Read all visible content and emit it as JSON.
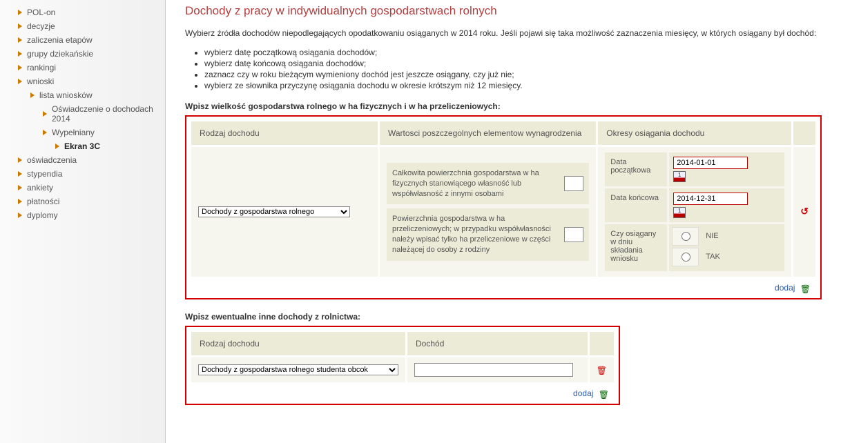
{
  "sidebar": {
    "items": [
      {
        "label": "POL-on",
        "indent": 1
      },
      {
        "label": "decyzje",
        "indent": 1
      },
      {
        "label": "zaliczenia etapów",
        "indent": 1
      },
      {
        "label": "grupy dziekańskie",
        "indent": 1
      },
      {
        "label": "rankingi",
        "indent": 1
      },
      {
        "label": "wnioski",
        "indent": 1
      },
      {
        "label": "lista wniosków",
        "indent": 2
      },
      {
        "label": "Oświadczenie o dochodach 2014",
        "indent": 3
      },
      {
        "label": "Wypełniany",
        "indent": 3
      },
      {
        "label": "Ekran 3C",
        "indent": 4,
        "current": true
      },
      {
        "label": "oświadczenia",
        "indent": 1
      },
      {
        "label": "stypendia",
        "indent": 1
      },
      {
        "label": "ankiety",
        "indent": 1
      },
      {
        "label": "płatności",
        "indent": 1
      },
      {
        "label": "dyplomy",
        "indent": 1
      }
    ]
  },
  "page": {
    "title": "Dochody z pracy w indywidualnych gospodarstwach rolnych",
    "intro": "Wybierz źródła dochodów niepodlegających opodatkowaniu osiąganych w 2014 roku. Jeśli pojawi się taka możliwość zaznaczenia miesięcy, w których osiągany był dochód:",
    "bullets": [
      "wybierz datę początkową osiągania dochodów;",
      "wybierz datę końcową osiągania dochodów;",
      "zaznacz czy w roku bieżącym wymieniony dochód jest jeszcze osiągany, czy już nie;",
      "wybierz ze słownika przyczynę osiągania dochodu w okresie krótszym niż 12 miesięcy."
    ],
    "section1_head": "Wpisz wielkość gospodarstwa rolnego w ha fizycznych i w ha przeliczeniowych:",
    "section2_head": "Wpisz ewentualne inne dochody z rolnictwa:"
  },
  "table1": {
    "headers": {
      "kind": "Rodzaj dochodu",
      "values": "Wartosci poszczegolnych elementow wynagrodzenia",
      "periods": "Okresy osiągania dochodu"
    },
    "kind_select": "Dochody z gospodarstwa rolnego",
    "row1_text": "Całkowita powierzchnia gospodarstwa w ha fizycznych stanowiącego własność lub współwłasność z innymi osobami",
    "row2_text": "Powierzchnia gospodarstwa w ha przeliczeniowych; w przypadku współwłasności należy wpisać tylko ha przeliczeniowe w części należącej do osoby z rodziny",
    "period": {
      "start_label": "Data początkowa",
      "start_value": "2014-01-01",
      "end_label": "Data końcowa",
      "end_value": "2014-12-31",
      "current_label": "Czy osiągany w dniu składania wniosku",
      "opt_no": "NIE",
      "opt_yes": "TAK"
    },
    "add_label": "dodaj"
  },
  "table2": {
    "headers": {
      "kind": "Rodzaj dochodu",
      "income": "Dochód"
    },
    "kind_select": "Dochody z gospodarstwa rolnego studenta obcok",
    "add_label": "dodaj"
  }
}
